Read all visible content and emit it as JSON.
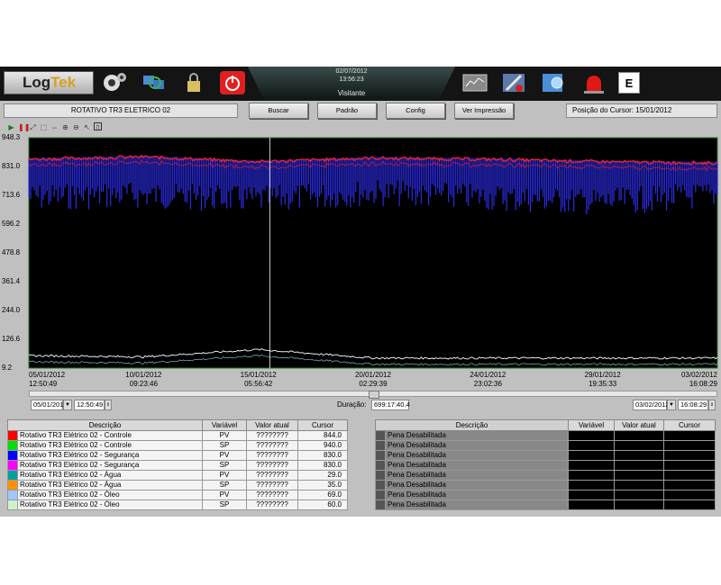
{
  "topbar": {
    "logo": {
      "log": "Log",
      "tek": "Tek"
    },
    "date": "02/07/2012",
    "time": "13:56:23",
    "user": "Visitante",
    "e_label": "E"
  },
  "toolbar": {
    "title": "ROTATIVO TR3 ELETRICO 02",
    "buttons": [
      "Buscar",
      "Padrão",
      "Config",
      "Ver Impressão"
    ],
    "cursor_position": "Posição do Cursor: 15/01/2012"
  },
  "chart": {
    "y_ticks": [
      "948.3",
      "831.0",
      "713.6",
      "596.2",
      "478.8",
      "361.4",
      "244.0",
      "126.6",
      "9.2"
    ],
    "x_ticks": [
      {
        "date": "05/01/2012",
        "time": "12:50:49"
      },
      {
        "date": "10/01/2012",
        "time": "09:23:46"
      },
      {
        "date": "15/01/2012",
        "time": "05:56:42"
      },
      {
        "date": "20/01/2012",
        "time": "02:29:39"
      },
      {
        "date": "24/01/2012",
        "time": "23:02:36"
      },
      {
        "date": "29/01/2012",
        "time": "19:35:33"
      },
      {
        "date": "03/02/2012",
        "time": "16:08:29"
      }
    ],
    "colors": {
      "background": "#000000",
      "red": "#ff2020",
      "blue": "#3030ff",
      "white": "#ffffff",
      "cursor": "#d0d0d0"
    },
    "cursor_fraction": 0.35
  },
  "chart_data": {
    "type": "line",
    "ylim": [
      9.2,
      948.3
    ],
    "x": [
      "05/01/2012 12:50:49",
      "10/01/2012 09:23:46",
      "15/01/2012 05:56:42",
      "20/01/2012 02:29:39",
      "24/01/2012 23:02:36",
      "29/01/2012 19:35:33",
      "03/02/2012 16:08:29"
    ],
    "series": [
      {
        "name": "Rotativo TR3 Elétrico 02 - Controle",
        "type": "PV",
        "color": "#ff2020",
        "values": [
          860,
          870,
          850,
          865,
          860,
          850,
          845
        ]
      },
      {
        "name": "Rotativo TR3 Elétrico 02 - Segurança",
        "type": "PV",
        "color": "#3030ff",
        "values": [
          780,
          790,
          770,
          800,
          780,
          760,
          790
        ]
      },
      {
        "name": "Rotativo TR3 Elétrico 02 - Óleo",
        "type": "PV",
        "color": "#ffffff",
        "values": [
          60,
          55,
          85,
          50,
          50,
          50,
          50
        ]
      }
    ]
  },
  "range": {
    "start_date": "05/01/2012",
    "start_time": "12:50:49",
    "duration_label": "Duração:",
    "duration": "699:17:40.4",
    "end_date": "03/02/2012",
    "end_time": "16:08:29"
  },
  "left_table": {
    "headers": [
      "Descrição",
      "Variável",
      "Valor atual",
      "Cursor"
    ],
    "rows": [
      {
        "color": "#ff0000",
        "desc": "Rotativo TR3 Elétrico 02 - Controle",
        "var": "PV",
        "val": "????????",
        "cur": "844.0"
      },
      {
        "color": "#00e000",
        "desc": "Rotativo TR3 Elétrico 02 - Controle",
        "var": "SP",
        "val": "????????",
        "cur": "940.0"
      },
      {
        "color": "#0000ff",
        "desc": "Rotativo TR3 Elétrico 02 - Segurança",
        "var": "PV",
        "val": "????????",
        "cur": "830.0"
      },
      {
        "color": "#ff00ff",
        "desc": "Rotativo TR3 Elétrico 02 - Segurança",
        "var": "SP",
        "val": "????????",
        "cur": "830.0"
      },
      {
        "color": "#00a0a0",
        "desc": "Rotativo TR3 Elétrico 02 - Água",
        "var": "PV",
        "val": "????????",
        "cur": "29.0"
      },
      {
        "color": "#ff9000",
        "desc": "Rotativo TR3 Elétrico 02 - Água",
        "var": "SP",
        "val": "????????",
        "cur": "35.0"
      },
      {
        "color": "#a0c8ff",
        "desc": "Rotativo TR3 Elétrico 02 - Óleo",
        "var": "PV",
        "val": "????????",
        "cur": "69.0"
      },
      {
        "color": "#d0f0d0",
        "desc": "Rotativo TR3 Elétrico 02 - Óleo",
        "var": "SP",
        "val": "????????",
        "cur": "60.0"
      }
    ]
  },
  "right_table": {
    "headers": [
      "Descrição",
      "Variável",
      "Valor atual",
      "Cursor"
    ],
    "rows": [
      "Pena Desabilitada",
      "Pena Desabilitada",
      "Pena Desabilitada",
      "Pena Desabilitada",
      "Pena Desabilitada",
      "Pena Desabilitada",
      "Pena Desabilitada",
      "Pena Desabilitada"
    ]
  }
}
